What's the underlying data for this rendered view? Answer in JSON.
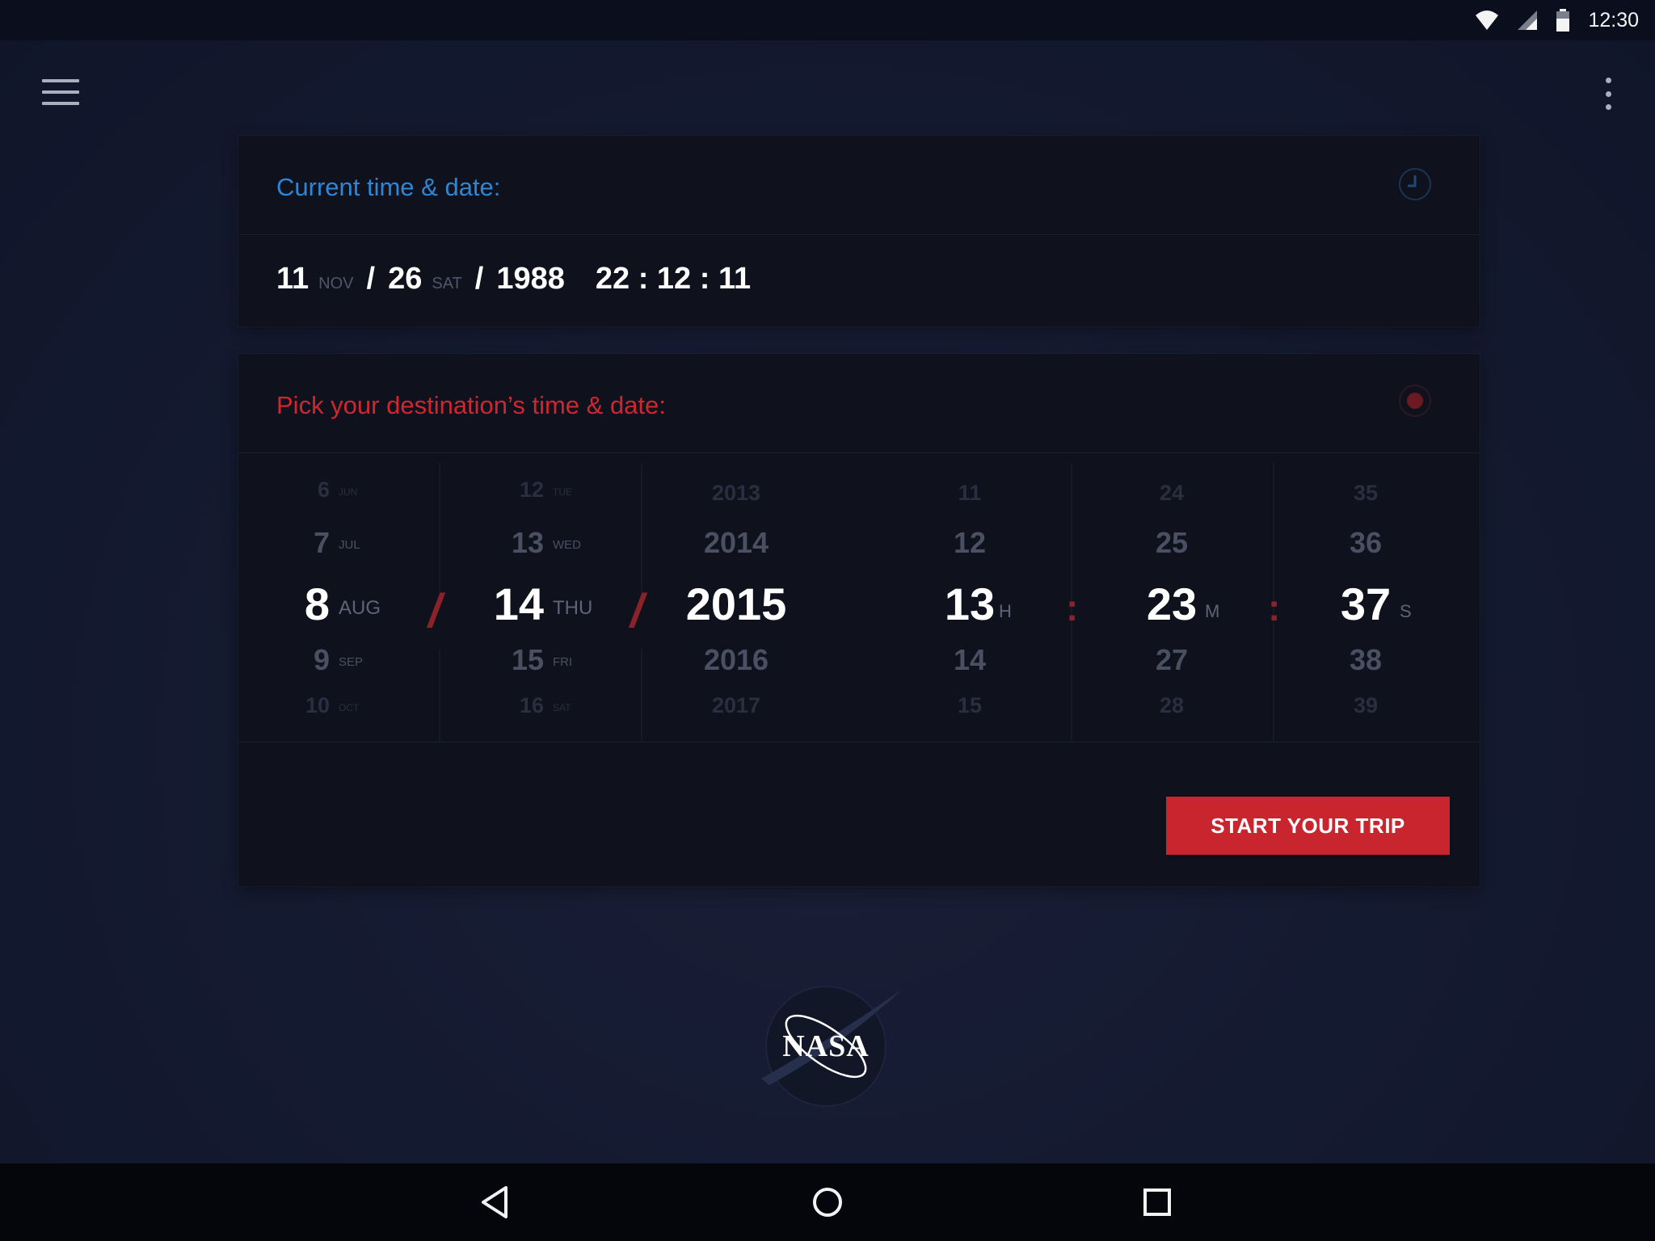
{
  "status_bar": {
    "time": "12:30"
  },
  "current": {
    "title": "Current time & date:",
    "month_num": "11",
    "month_lbl": "NOV",
    "day_num": "26",
    "day_lbl": "SAT",
    "year": "1988",
    "time": "22 : 12 : 11"
  },
  "destination": {
    "title": "Pick your destination’s time & date:",
    "button_label": "START YOUR TRIP",
    "months": [
      {
        "num": "6",
        "lbl": "JUN"
      },
      {
        "num": "7",
        "lbl": "JUL"
      },
      {
        "num": "8",
        "lbl": "AUG"
      },
      {
        "num": "9",
        "lbl": "SEP"
      },
      {
        "num": "10",
        "lbl": "OCT"
      }
    ],
    "days": [
      {
        "num": "12",
        "lbl": "TUE"
      },
      {
        "num": "13",
        "lbl": "WED"
      },
      {
        "num": "14",
        "lbl": "THU"
      },
      {
        "num": "15",
        "lbl": "FRI"
      },
      {
        "num": "16",
        "lbl": "SAT"
      }
    ],
    "years": [
      "2013",
      "2014",
      "2015",
      "2016",
      "2017"
    ],
    "hours": [
      "11",
      "12",
      "13",
      "14",
      "15"
    ],
    "hour_unit": "H",
    "minutes": [
      "24",
      "25",
      "23",
      "27",
      "28"
    ],
    "minute_unit": "M",
    "seconds": [
      "35",
      "36",
      "37",
      "38",
      "39"
    ],
    "second_unit": "S",
    "date_separator": "/",
    "time_separator": ":"
  },
  "logo": {
    "text": "NASA"
  },
  "colors": {
    "accent_red": "#c9252e",
    "accent_blue": "#2f86d3"
  }
}
